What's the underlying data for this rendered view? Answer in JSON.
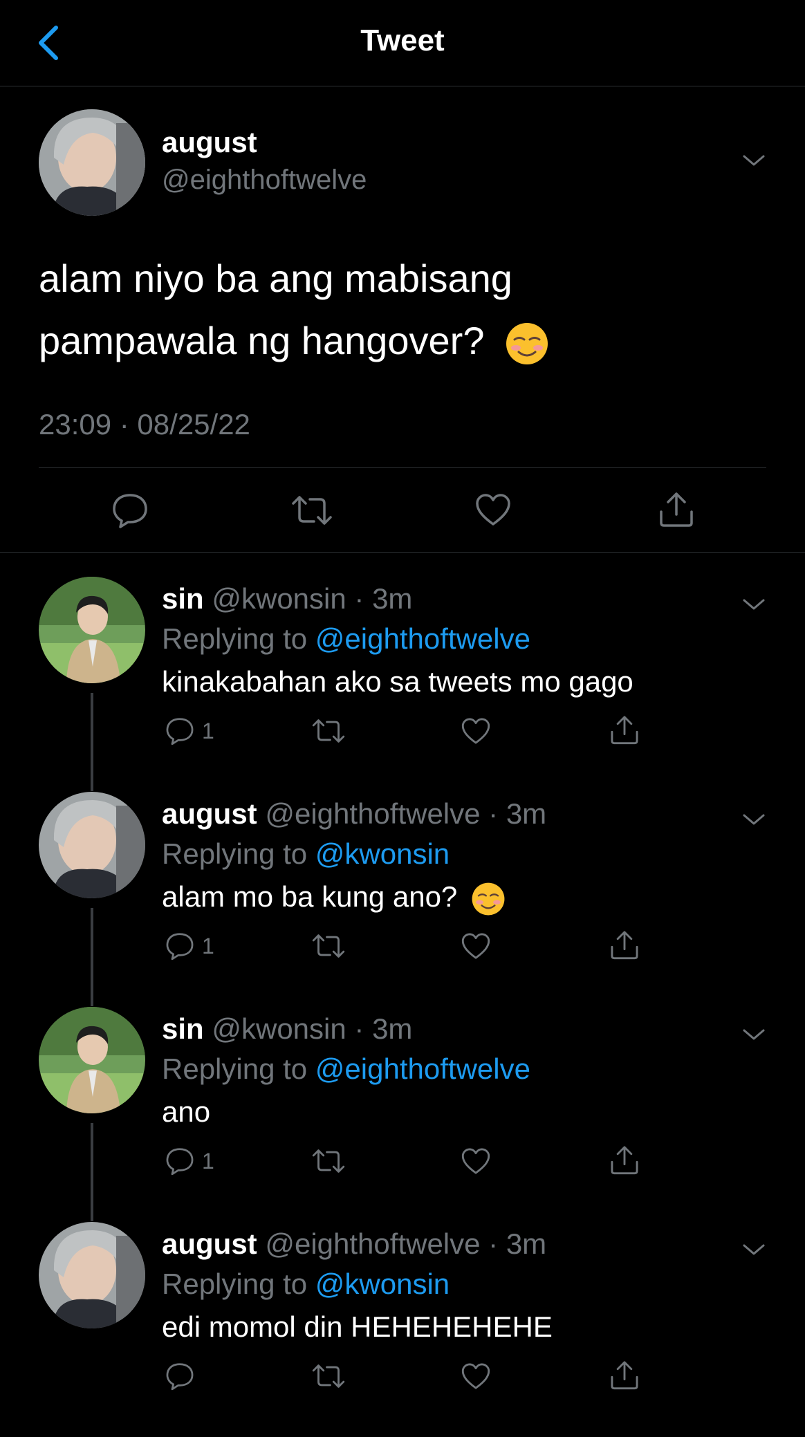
{
  "header": {
    "title": "Tweet"
  },
  "main_tweet": {
    "name": "august",
    "handle": "@eighthoftwelve",
    "text_line1": "alam niyo ba ang mabisang",
    "text_line2": "pampawala ng hangover?",
    "emoji": "☺️",
    "timestamp": "23:09 · 08/25/22"
  },
  "replies": [
    {
      "name": "sin",
      "handle": "@kwonsin",
      "time": "3m",
      "replying_label": "Replying to",
      "replying_to": "@eighthoftwelve",
      "text": "kinakabahan ako sa tweets mo gago",
      "reply_count": "1"
    },
    {
      "name": "august",
      "handle": "@eighthoftwelve",
      "time": "3m",
      "replying_label": "Replying to",
      "replying_to": "@kwonsin",
      "text": "alam mo ba kung ano?",
      "emoji": "☺️",
      "reply_count": "1"
    },
    {
      "name": "sin",
      "handle": "@kwonsin",
      "time": "3m",
      "replying_label": "Replying to",
      "replying_to": "@eighthoftwelve",
      "text": "ano",
      "reply_count": "1"
    },
    {
      "name": "august",
      "handle": "@eighthoftwelve",
      "time": "3m",
      "replying_label": "Replying to",
      "replying_to": "@kwonsin",
      "text": "edi momol din HEHEHEHEHE",
      "reply_count": ""
    }
  ],
  "colors": {
    "background": "#000000",
    "text_primary": "#ffffff",
    "text_secondary": "#71767b",
    "accent": "#1d9bf0",
    "divider": "#2f3336"
  },
  "icons": {
    "back": "chevron-left-icon",
    "caret": "chevron-down-icon",
    "reply": "reply-bubble-icon",
    "retweet": "retweet-icon",
    "like": "heart-icon",
    "share": "share-icon"
  }
}
